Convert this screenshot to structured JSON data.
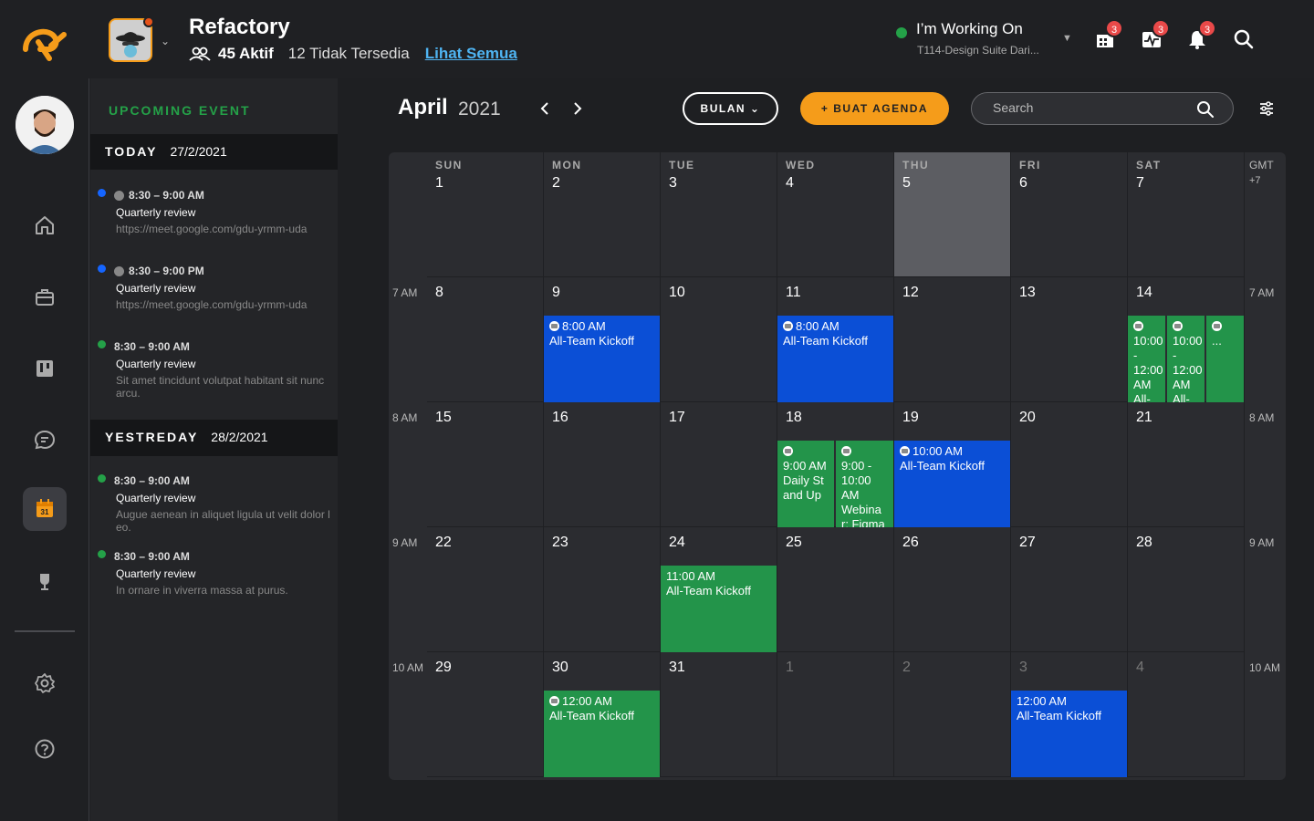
{
  "header": {
    "team_name": "Refactory",
    "active_count": "45 Aktif",
    "unavailable_count": "12 Tidak Tersedia",
    "see_all": "Lihat Semua",
    "working_on_label": "I’m Working On",
    "working_on_task": "T114-Design Suite Dari...",
    "badges": [
      "3",
      "3",
      "3"
    ]
  },
  "upcoming": {
    "title": "UPCOMING EVENT",
    "today_label": "TODAY",
    "today_date": "27/2/2021",
    "yesterday_label": "YESTREDAY",
    "yesterday_date": "28/2/2021",
    "today_events": [
      {
        "time": "8:30 – 9:00 AM",
        "title": "Quarterly review",
        "desc": "https://meet.google.com/gdu-yrmm-uda",
        "dot": "#1565ff",
        "meet": true
      },
      {
        "time": "8:30 – 9:00 PM",
        "title": "Quarterly review",
        "desc": "https://meet.google.com/gdu-yrmm-uda",
        "dot": "#1565ff",
        "meet": true
      },
      {
        "time": "8:30 – 9:00 AM",
        "title": "Quarterly review",
        "desc": "Sit amet tincidunt volutpat habitant sit nunc arcu.",
        "dot": "#24a148",
        "meet": false
      }
    ],
    "yesterday_events": [
      {
        "time": "8:30 – 9:00 AM",
        "title": "Quarterly review",
        "desc": "Augue aenean in aliquet ligula ut velit dolor leo.",
        "dot": "#24a148"
      },
      {
        "time": "8:30 – 9:00 AM",
        "title": "Quarterly review",
        "desc": "In ornare in viverra massa at purus.",
        "dot": "#24a148"
      }
    ]
  },
  "calendar": {
    "month": "April",
    "year": "2021",
    "view_button": "BULAN",
    "create_button": "+ BUAT AGENDA",
    "search_placeholder": "Search",
    "gmt_label": "GMT",
    "gmt_offset": "+7",
    "day_names": [
      "SUN",
      "MON",
      "TUE",
      "WED",
      "THU",
      "FRI",
      "SAT"
    ],
    "row_times": [
      "",
      "7 AM",
      "8 AM",
      "9 AM",
      "10 AM"
    ],
    "weeks": [
      [
        "1",
        "2",
        "3",
        "4",
        "5",
        "6",
        "7"
      ],
      [
        "8",
        "9",
        "10",
        "11",
        "12",
        "13",
        "14"
      ],
      [
        "15",
        "16",
        "17",
        "18",
        "19",
        "20",
        "21"
      ],
      [
        "22",
        "23",
        "24",
        "25",
        "26",
        "27",
        "28"
      ],
      [
        "29",
        "30",
        "31",
        "1",
        "2",
        "3",
        "4"
      ]
    ],
    "events": {
      "mon9": {
        "time": "8:00 AM",
        "title": "All-Team Kickoff"
      },
      "wed11": {
        "time": "8:00 AM",
        "title": "All-Team Kickoff"
      },
      "sat14a": {
        "time": "10:00 - 12:00 AM",
        "title": "All-T..."
      },
      "sat14b": {
        "time": "10:00 - 12:00 AM",
        "title": "All-T..."
      },
      "sat14c": {
        "title": "..."
      },
      "wed18a": {
        "time": "9:00 AM",
        "title": "Daily Stand Up"
      },
      "wed18b": {
        "time": "9:00 - 10:00 AM",
        "title": "Webinar: Figma"
      },
      "thu19": {
        "time": "10:00 AM",
        "title": "All-Team Kickoff"
      },
      "tue24": {
        "time": "11:00 AM",
        "title": "All-Team Kickoff"
      },
      "mon30": {
        "time": "12:00 AM",
        "title": "All-Team Kickoff"
      },
      "fri3": {
        "time": "12:00 AM",
        "title": "All-Team Kickoff"
      }
    }
  },
  "colors": {
    "accent": "#f59c1a",
    "green": "#24a148",
    "blue": "#0b4fd6",
    "today_highlight": "#5c5d62"
  }
}
